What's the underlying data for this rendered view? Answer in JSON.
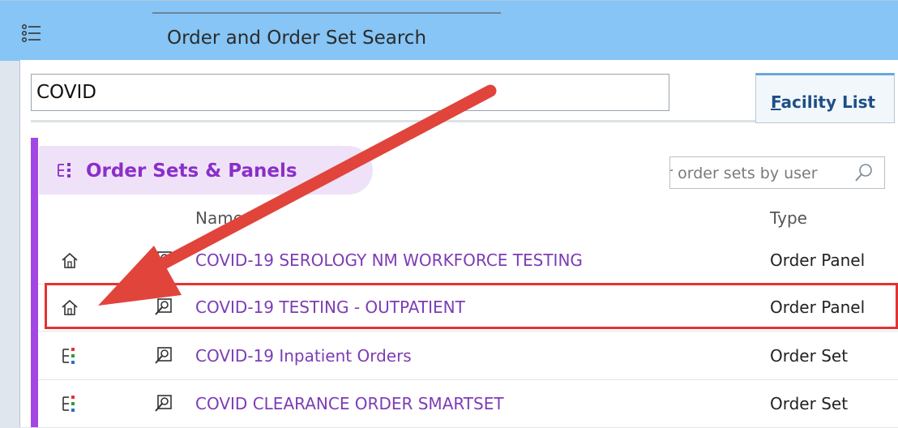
{
  "window": {
    "title": "Order and Order Set Search"
  },
  "search": {
    "value": "COVID"
  },
  "tabs": {
    "facility_list": {
      "accel": "F",
      "rest": "acility List"
    }
  },
  "section": {
    "label": "Order Sets & Panels",
    "accent": "#a347e4"
  },
  "filter": {
    "placeholder_partial": "Filter order sets by user"
  },
  "columns": {
    "name": "Name",
    "type": "Type"
  },
  "rows": [
    {
      "icon": "home-icon",
      "name": "COVID-19 SEROLOGY NM WORKFORCE TESTING",
      "type": "Order Panel"
    },
    {
      "icon": "home-icon",
      "name": "COVID-19 TESTING - OUTPATIENT",
      "type": "Order Panel"
    },
    {
      "icon": "order-set-icon",
      "name": "COVID-19 Inpatient Orders",
      "type": "Order Set"
    },
    {
      "icon": "order-set-icon",
      "name": "COVID CLEARANCE ORDER SMARTSET",
      "type": "Order Set"
    }
  ],
  "annotation": {
    "highlight_color": "#e53232",
    "arrow_color": "#e0443b"
  }
}
